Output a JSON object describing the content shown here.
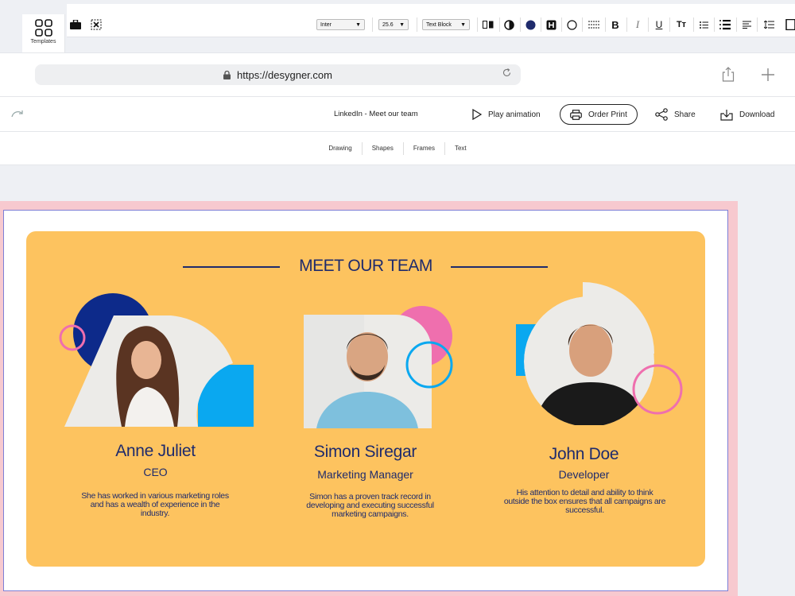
{
  "toolbar": {
    "templates_label": "Templates",
    "font_family": "Inter",
    "font_size": "25.6",
    "block_type": "Text Block",
    "bold": "B",
    "italic": "I",
    "underline": "U",
    "text_size": "Tт"
  },
  "browser": {
    "url": "https://desygner.com"
  },
  "header": {
    "doc_title": "LinkedIn - Meet our team",
    "play_animation": "Play animation",
    "order_print": "Order Print",
    "share": "Share",
    "download": "Download"
  },
  "tool_tabs": [
    "Drawing",
    "Shapes",
    "Frames",
    "Text"
  ],
  "design": {
    "heading": "MEET OUR TEAM",
    "members": [
      {
        "name": "Anne Juliet",
        "role": "CEO",
        "bio": "She has worked in various marketing roles and has a wealth of experience in the industry."
      },
      {
        "name": "Simon Siregar",
        "role": "Marketing Manager",
        "bio": "Simon has a proven track record in developing and executing successful marketing campaigns."
      },
      {
        "name": "John Doe",
        "role": "Developer",
        "bio": "His attention to detail and ability to think outside the box ensures that all campaigns are successful."
      }
    ]
  },
  "colors": {
    "card_bg": "#fdc35f",
    "navy": "#1f2b6c",
    "blue": "#0aa8f0",
    "pink": "#ef6fae",
    "dark_blue": "#0d2a8a",
    "selection": "#f7c9cf"
  }
}
